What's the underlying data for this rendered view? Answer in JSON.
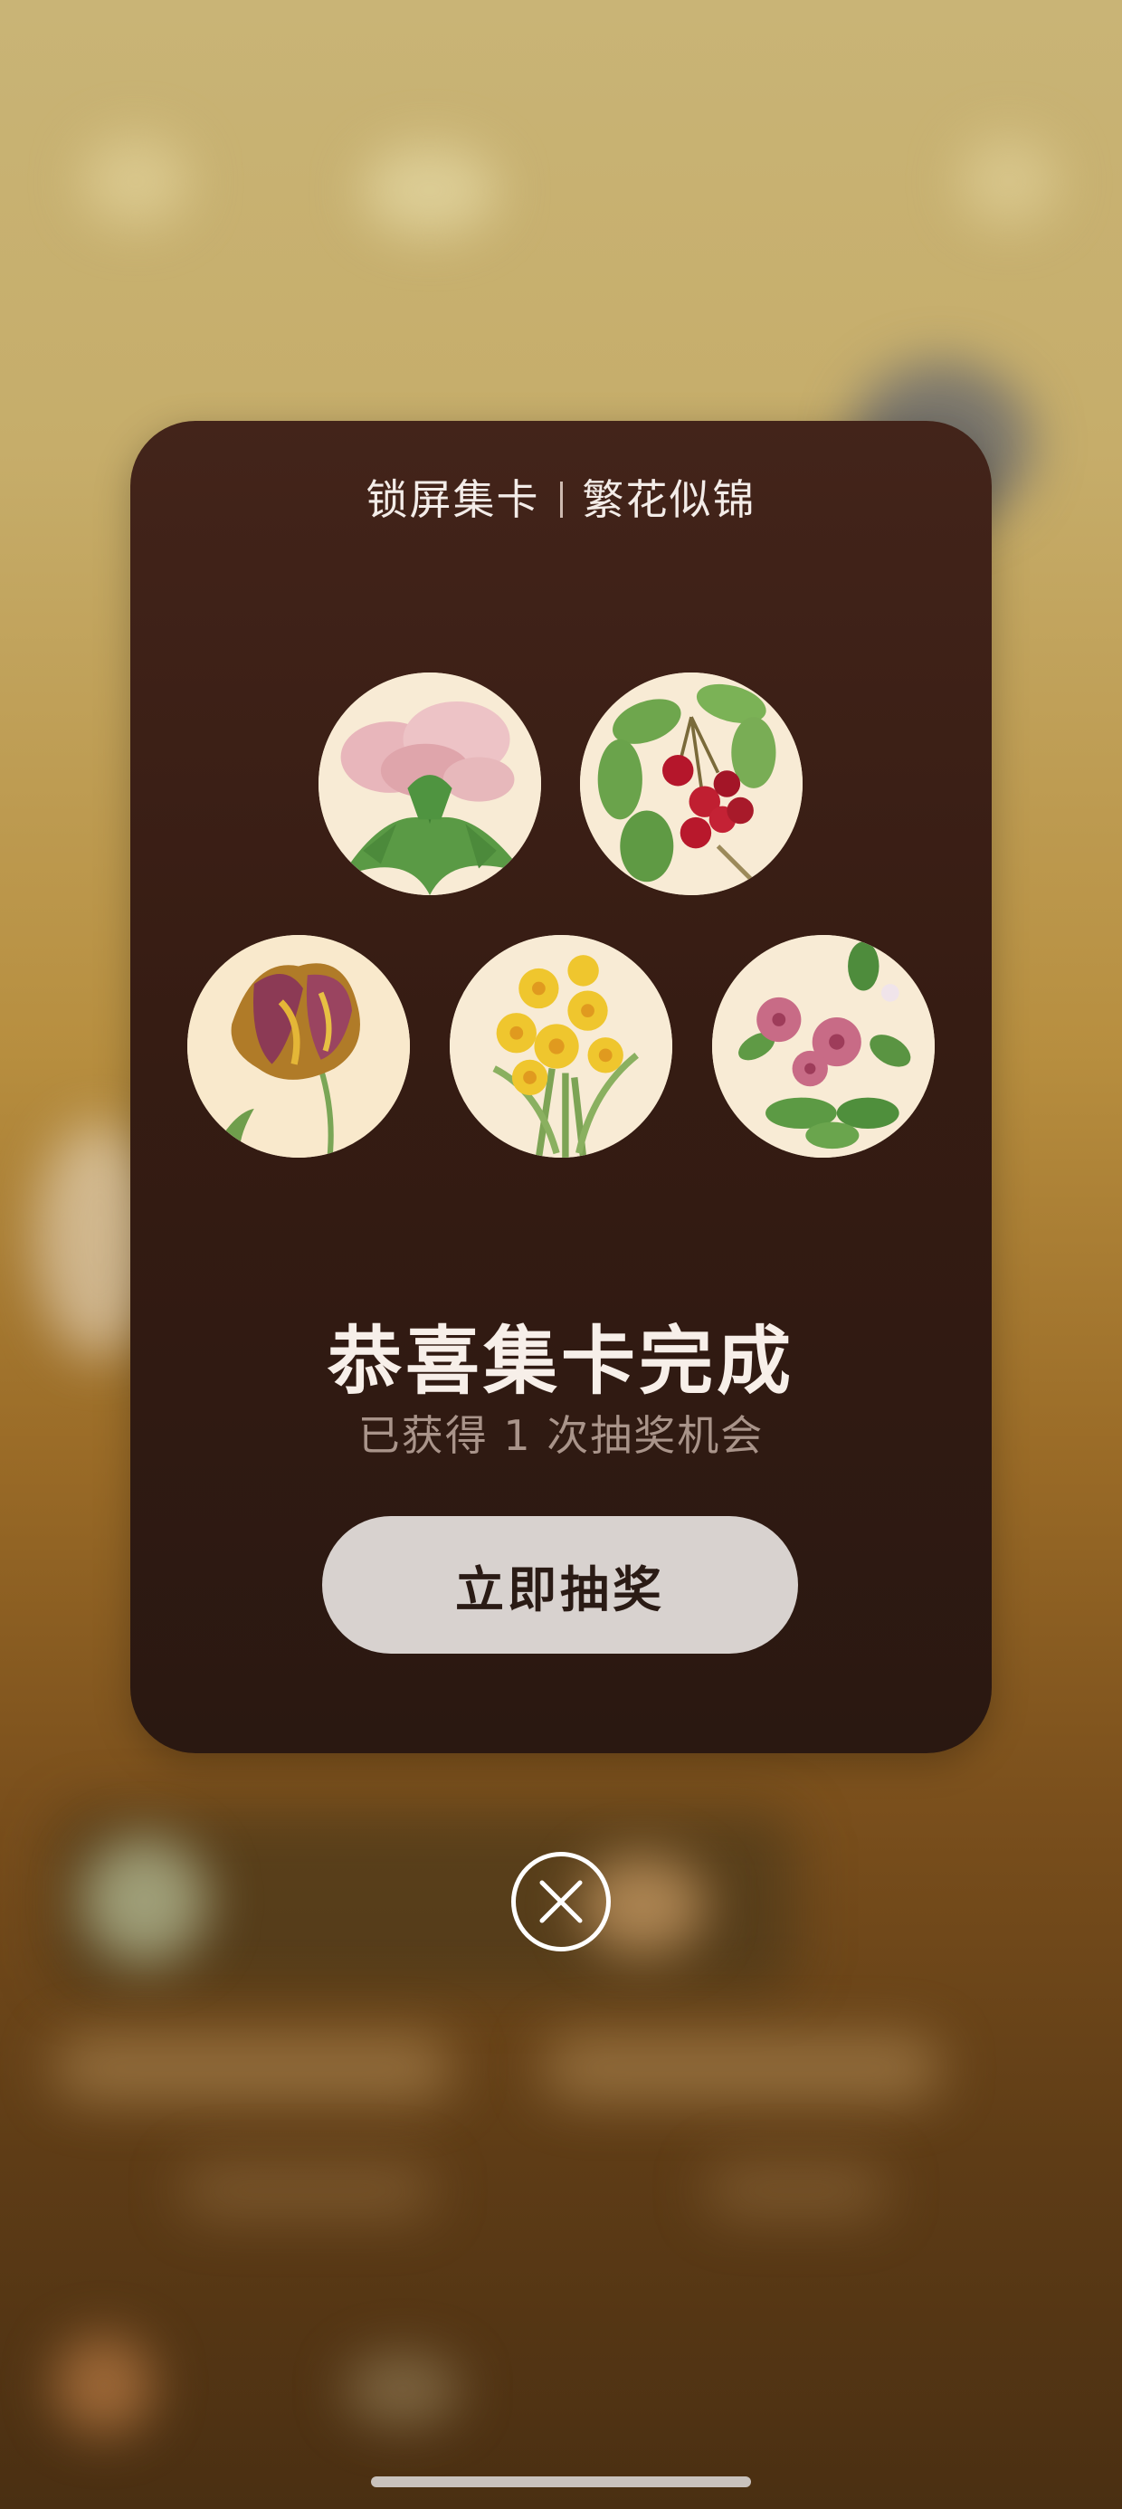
{
  "card": {
    "title_left": "锁屏集卡",
    "title_right": "繁花似锦",
    "flowers": [
      {
        "name": "peony-card"
      },
      {
        "name": "cherry-card"
      },
      {
        "name": "tulip-card"
      },
      {
        "name": "narcissus-card"
      },
      {
        "name": "periwinkle-card"
      }
    ],
    "congrats": "恭喜集卡完成",
    "subtitle": "已获得 1 次抽奖机会",
    "button_label": "立即抽奖"
  },
  "icons": {
    "close": "close-icon"
  },
  "colors": {
    "card_bg": "#3a1f15",
    "button_bg": "#d8d2cf",
    "title_text": "#f3ece8"
  }
}
